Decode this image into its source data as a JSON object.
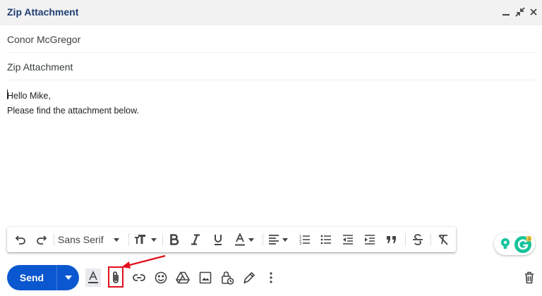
{
  "window": {
    "title": "Zip Attachment"
  },
  "recipients": {
    "to": "Conor McGregor"
  },
  "subject": {
    "value": "Zip Attachment"
  },
  "message": {
    "line1": "Hello Mike,",
    "line2": "Please find the attachment below."
  },
  "formatting": {
    "font": "Sans Serif"
  },
  "send": {
    "label": "Send"
  },
  "colors": {
    "accent": "#0b57d0",
    "title": "#1f3e72",
    "highlight": "#e3101b"
  }
}
